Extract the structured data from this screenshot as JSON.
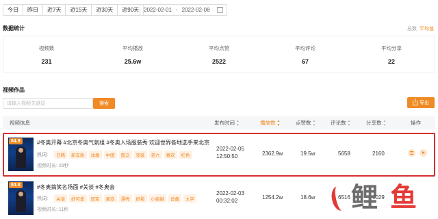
{
  "date_filter": {
    "tabs": [
      "今日",
      "昨日",
      "近7天",
      "近15天",
      "近30天",
      "近90天"
    ],
    "start_date": "2022-02-01",
    "separator": "-",
    "end_date": "2022-02-08"
  },
  "stats": {
    "title": "数据统计",
    "links": [
      "总数",
      "平均值"
    ],
    "items": [
      {
        "label": "视频数",
        "value": "231"
      },
      {
        "label": "平均播放",
        "value": "25.6w"
      },
      {
        "label": "平均点赞",
        "value": "2522"
      },
      {
        "label": "平均评论",
        "value": "67"
      },
      {
        "label": "平均分享",
        "value": "22"
      }
    ]
  },
  "works": {
    "title": "视频作品",
    "search_placeholder": "请输入视频关键词",
    "search_button": "搜索",
    "export_button": "导出"
  },
  "table": {
    "headers": {
      "info": "视频信息",
      "publish_time": "发布时间",
      "plays": "播放数",
      "likes": "点赞数",
      "comments": "评论数",
      "shares": "分享数",
      "actions": "操作"
    },
    "rows": [
      {
        "score": "84.9",
        "title": "#冬奥开幕 #北京冬奥气氛组 #冬奥入场服装秀 欢迎世界各地选手来北京。",
        "hot_label": "热词:",
        "tags": [
          "日韩",
          "新年粉",
          "冰墩",
          "中国",
          "国泛",
          "变装",
          "老六",
          "喜欢",
          "红色"
        ],
        "duration_label": "视频时长: 28秒",
        "publish_date": "2022-02-05",
        "publish_time": "12:50:50",
        "plays": "2362.9w",
        "likes": "19.5w",
        "comments": "5658",
        "shares": "2160",
        "highlighted": true
      },
      {
        "score": "84.8",
        "title": "#冬奥搞笑名场面 #关谈 #冬奥会",
        "hot_label": "热词:",
        "tags": [
          "关谈",
          "好可爱",
          "冠军",
          "喜欢",
          "漂亮",
          "好看",
          "小姐姐",
          "设备",
          "大学"
        ],
        "duration_label": "视频时长: 11秒",
        "publish_date": "2022-02-03",
        "publish_time": "00:32:02",
        "plays": "1254.2w",
        "likes": "18.6w",
        "comments": "6516",
        "shares": "1029",
        "highlighted": false
      }
    ]
  },
  "watermark": {
    "chars": [
      "鲤",
      "鱼"
    ]
  },
  "colors": {
    "accent": "#f08a24",
    "highlight_border": "#d32f2f",
    "watermark_red": "#e53935",
    "watermark_gray": "#6d6d6d"
  }
}
